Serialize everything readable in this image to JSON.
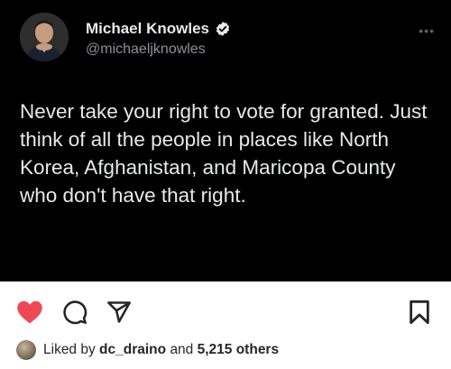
{
  "tweet": {
    "author_name": "Michael Knowles",
    "author_handle": "@michaeljknowles",
    "text": "Never take your right to vote for granted. Just think of all the people in places like North Korea, Afghanistan, and Maricopa County who don't have that right.",
    "avatar_icon": "profile-photo",
    "verified_icon": "verified-badge-icon",
    "more_icon": "more-dots-icon"
  },
  "post_actions": {
    "icons": [
      "heart-icon",
      "comment-icon",
      "share-icon",
      "bookmark-icon"
    ],
    "heart_color": "#ed4956"
  },
  "likes": {
    "prefix": "Liked by",
    "user": "dc_draino",
    "joiner": "and",
    "others": "5,215 others"
  },
  "colors": {
    "tweet_background": "#000000",
    "tweet_text": "#e7e9ea",
    "handle_text": "#8b9198"
  }
}
